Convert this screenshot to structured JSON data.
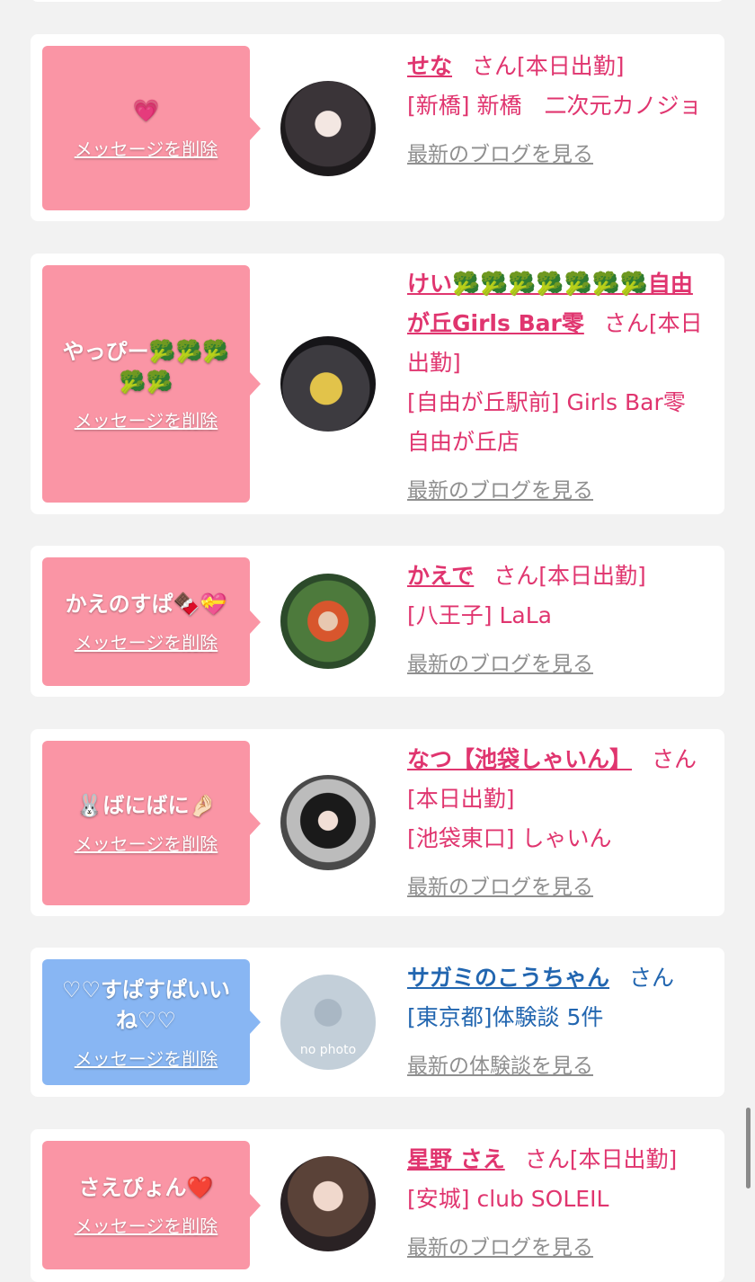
{
  "common": {
    "delete_label": "メッセージを削除",
    "blog_label": "最新のブログを見る",
    "review_label": "最新の体験談を見る",
    "san": "さん",
    "no_photo": "no photo"
  },
  "cards": [
    {
      "message": "💗",
      "name": "せな",
      "suffix": "[本日出勤]",
      "location": "[新橋] 新橋　二次元カノジョ"
    },
    {
      "message": "やっぴー🥦🥦🥦🥦🥦",
      "name": "けい🥦🥦🥦🥦🥦🥦🥦自由が丘Girls Bar零",
      "suffix": "[本日出勤]",
      "location": "[自由が丘駅前] Girls Bar零　自由が丘店"
    },
    {
      "message": "かえのすぱ🍫💝",
      "name": "かえで",
      "suffix": "[本日出勤]",
      "location": "[八王子] LaLa"
    },
    {
      "message": "🐰ばにばに🤌🏻",
      "name": "なつ【池袋しゃいん】",
      "suffix": "[本日出勤]",
      "location": "[池袋東口] しゃいん"
    },
    {
      "message": "♡♡すぱすぱいいね♡♡",
      "name": "サガミのこうちゃん",
      "suffix": "",
      "location": "[東京都]体験談 5件"
    },
    {
      "message": "さえぴょん❤️",
      "name": "星野 さえ",
      "suffix": "[本日出勤]",
      "location": "[安城] club SOLEIL"
    }
  ]
}
